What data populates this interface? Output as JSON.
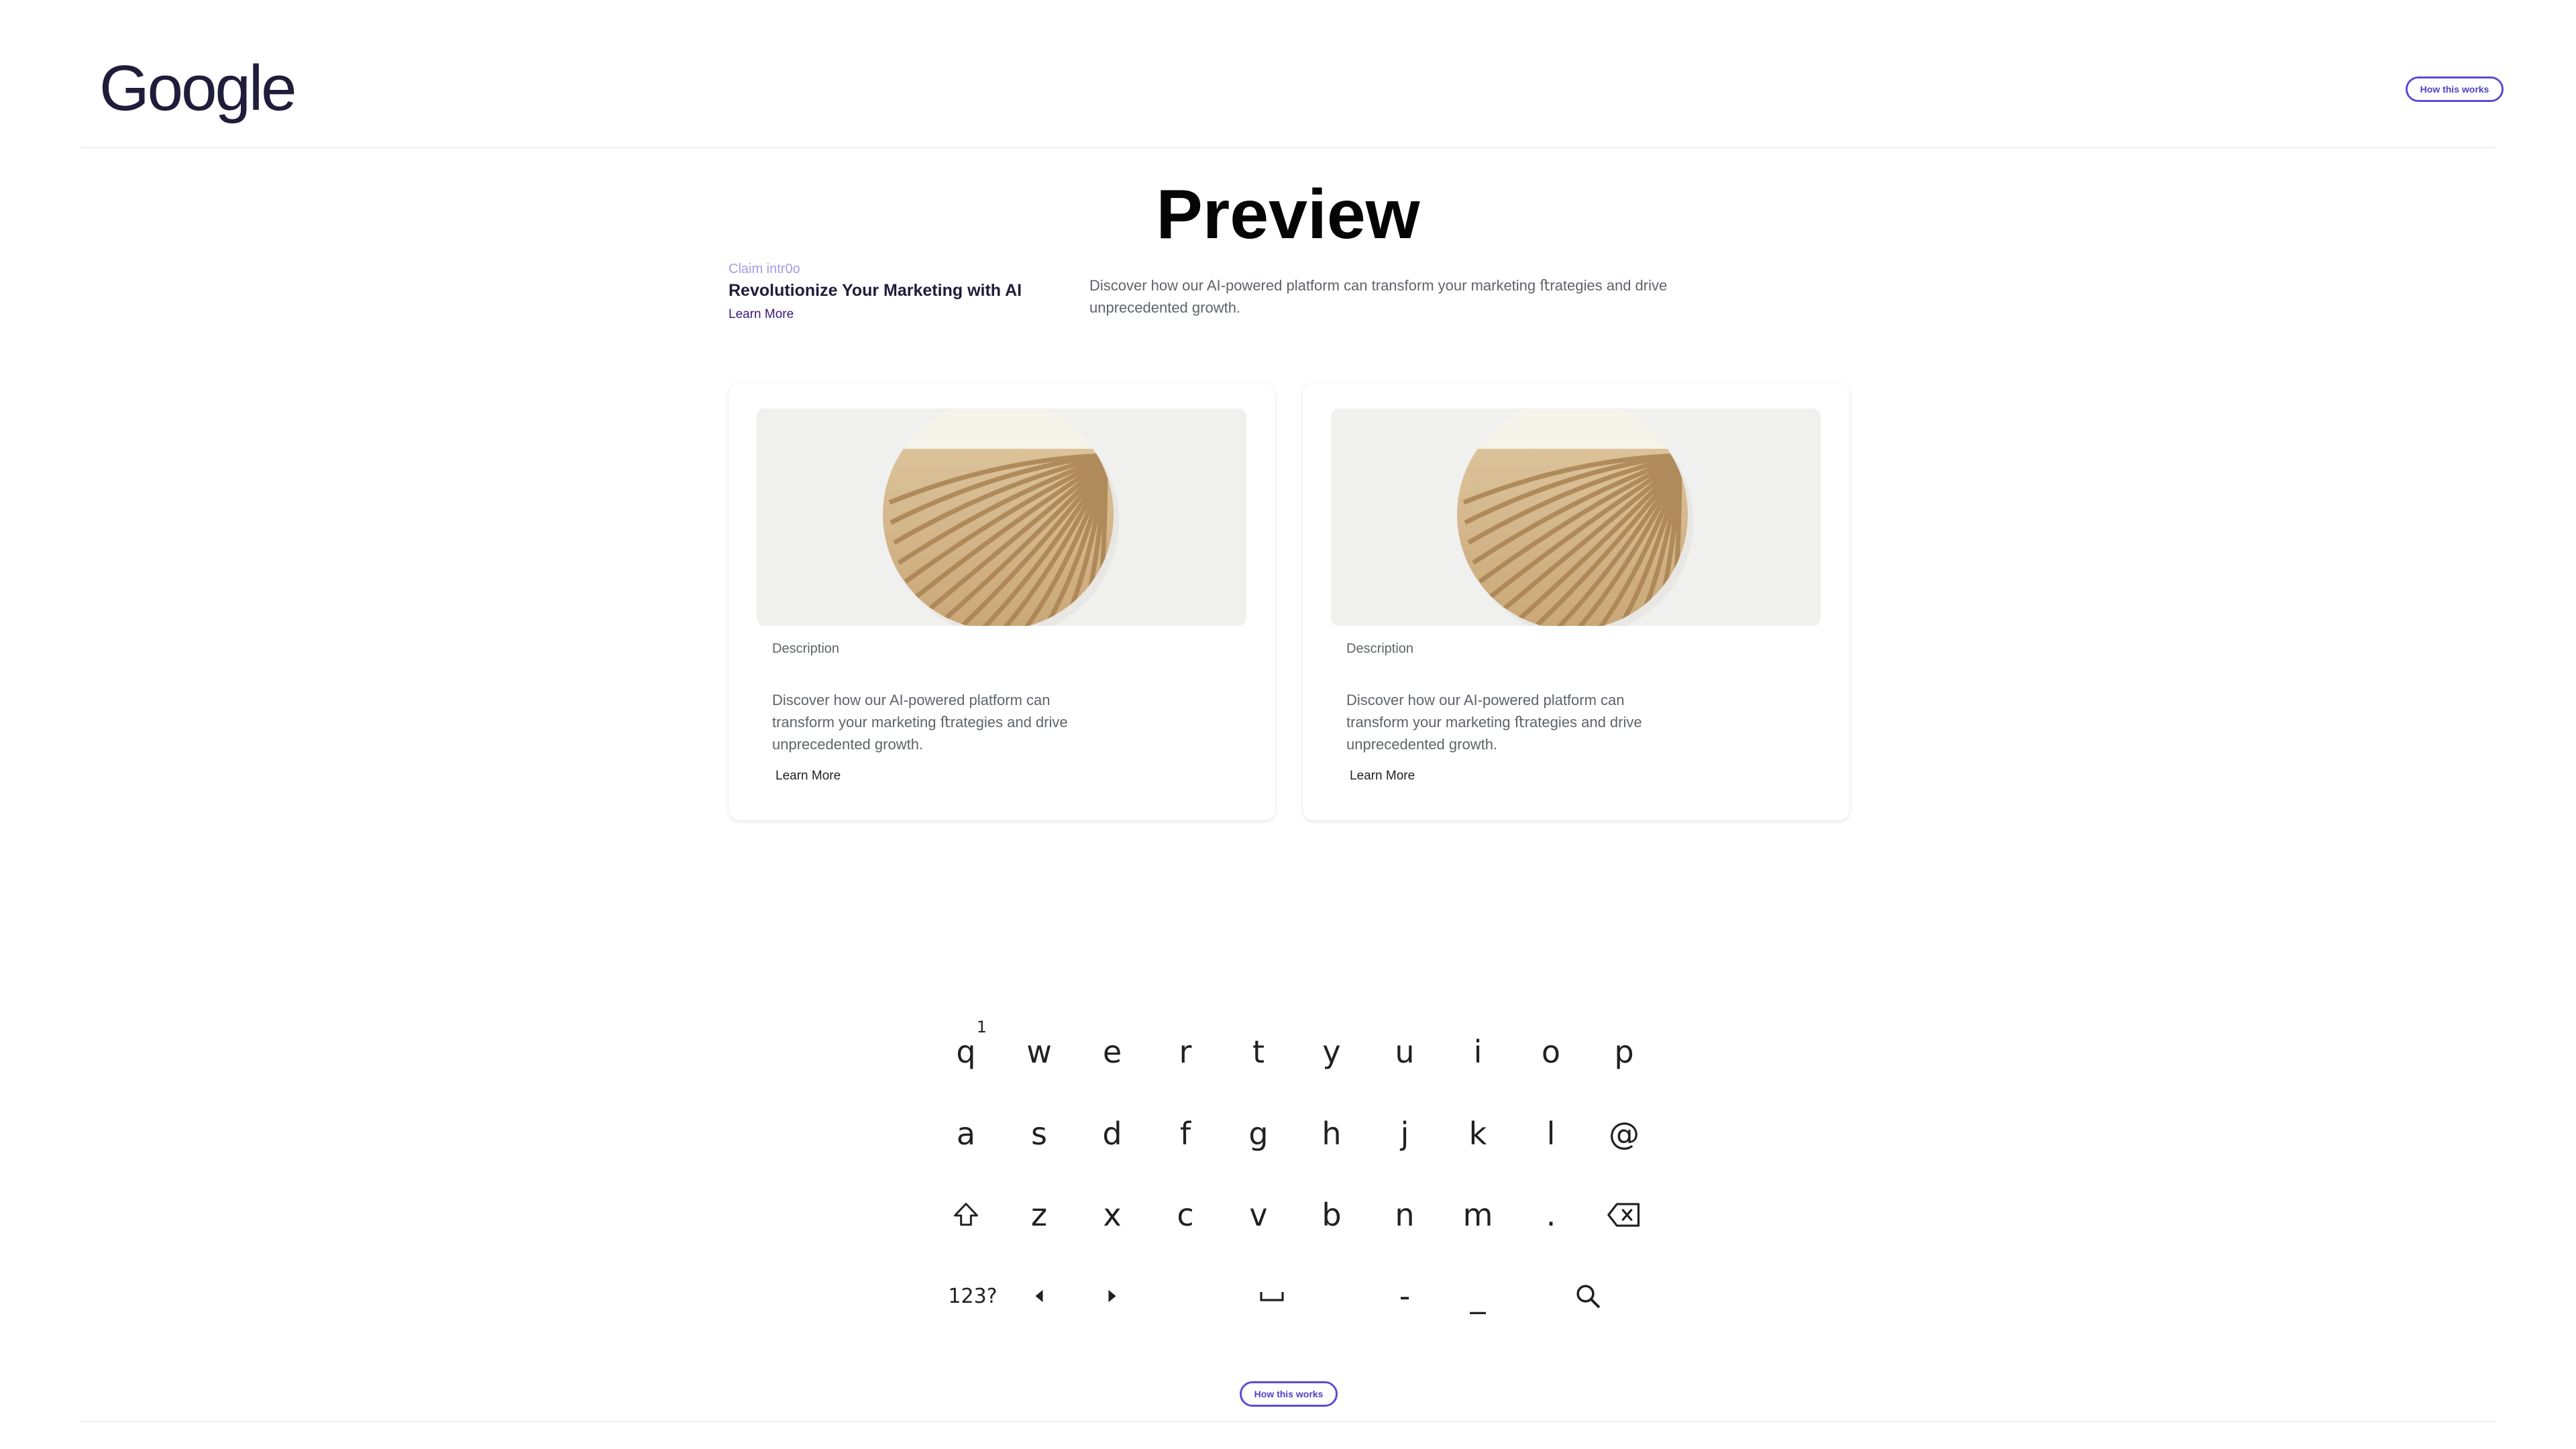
{
  "header": {
    "logo_text": "Google",
    "how_button": "How this works"
  },
  "preview": {
    "title": "Preview"
  },
  "intro": {
    "claim": "Claim intr0o",
    "title": "Revolutionize Your Marketing with AI",
    "learn_more": "Learn More",
    "description": "Discover how our AI-powered platform can transform your marketing ﬅrategies and drive unprecedented growth."
  },
  "cards": [
    {
      "label": "Description",
      "description": "Discover how our AI-powered platform can transform your marketing ﬅrategies and drive unprecedented growth.",
      "learn_more": "Learn More"
    },
    {
      "label": "Description",
      "description": "Discover how our AI-powered platform can transform your marketing ﬅrategies and drive unprecedented growth.",
      "learn_more": "Learn More"
    }
  ],
  "keyboard": {
    "row1": [
      "q",
      "w",
      "e",
      "r",
      "t",
      "y",
      "u",
      "i",
      "o",
      "p"
    ],
    "row1_hint": "1",
    "row2": [
      "a",
      "s",
      "d",
      "f",
      "g",
      "h",
      "j",
      "k",
      "l",
      "@"
    ],
    "row3": [
      "z",
      "x",
      "c",
      "v",
      "b",
      "n",
      "m",
      "."
    ],
    "row4_numbers": "123?",
    "row4_dash": "-",
    "row4_underscore": "_"
  },
  "footer": {
    "how_button": "How this works"
  },
  "colors": {
    "accent": "#5b4bd6",
    "claim": "#a99be6",
    "title_dark": "#1f1d3a",
    "learn_more": "#3a1a7a"
  },
  "icons": [
    "shift-icon",
    "backspace-icon",
    "arrow-left-icon",
    "arrow-right-icon",
    "space-icon",
    "search-icon"
  ]
}
